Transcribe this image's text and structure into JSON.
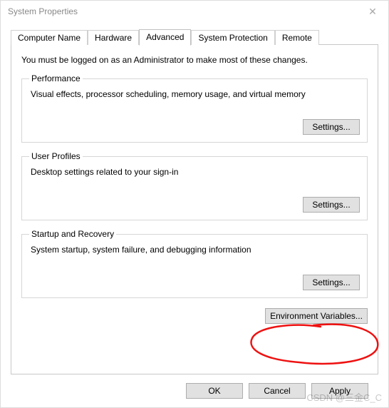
{
  "window": {
    "title": "System Properties",
    "close_icon": "✕"
  },
  "tabs": {
    "computer_name": "Computer Name",
    "hardware": "Hardware",
    "advanced": "Advanced",
    "system_protection": "System Protection",
    "remote": "Remote"
  },
  "advanced_page": {
    "admin_note": "You must be logged on as an Administrator to make most of these changes.",
    "performance": {
      "legend": "Performance",
      "desc": "Visual effects, processor scheduling, memory usage, and virtual memory",
      "settings_label": "Settings..."
    },
    "user_profiles": {
      "legend": "User Profiles",
      "desc": "Desktop settings related to your sign-in",
      "settings_label": "Settings..."
    },
    "startup_recovery": {
      "legend": "Startup and Recovery",
      "desc": "System startup, system failure, and debugging information",
      "settings_label": "Settings..."
    },
    "env_vars_label": "Environment Variables..."
  },
  "dialog_buttons": {
    "ok": "OK",
    "cancel": "Cancel",
    "apply": "Apply"
  },
  "watermark": "CSDN @三金C_C"
}
